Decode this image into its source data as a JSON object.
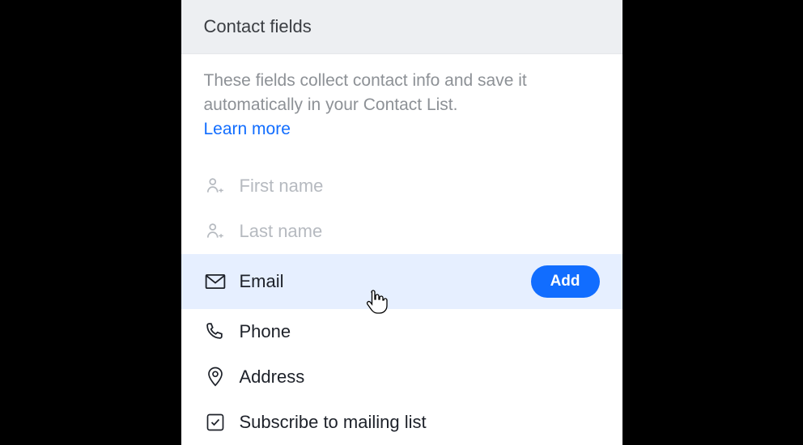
{
  "header": {
    "title": "Contact fields"
  },
  "description": {
    "text": "These fields collect contact info and save it automatically in your Contact List.",
    "learn_more": "Learn more"
  },
  "fields": {
    "first_name": {
      "label": "First name"
    },
    "last_name": {
      "label": "Last name"
    },
    "email": {
      "label": "Email",
      "add_button": "Add"
    },
    "phone": {
      "label": "Phone"
    },
    "address": {
      "label": "Address"
    },
    "subscribe": {
      "label": "Subscribe to mailing list"
    }
  }
}
